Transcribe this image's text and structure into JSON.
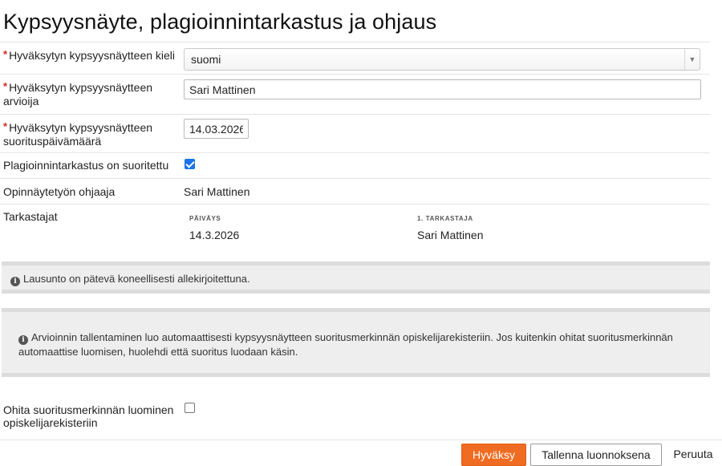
{
  "page": {
    "title": "Kypsyysnäyte, plagioinnintarkastus ja ohjaus"
  },
  "form": {
    "required_mark": "*",
    "language": {
      "label": "Hyväksytyn kypsyysnäytteen kieli",
      "value": "suomi"
    },
    "evaluator": {
      "label_line1": "Hyväksytyn kypsyysnäytteen",
      "label_line2": "arvioija",
      "value": "Sari Mattinen"
    },
    "date": {
      "label_line1": "Hyväksytyn kypsyysnäytteen",
      "label_line2": "suorituspäivämäärä",
      "value": "14.03.2026"
    },
    "plagiarism_check": {
      "label": "Plagioinnintarkastus on suoritettu",
      "checked": true
    },
    "supervisor": {
      "label": "Opinnäytetyön ohjaaja",
      "value": "Sari Mattinen"
    },
    "reviewers": {
      "label": "Tarkastajat",
      "headers": {
        "date": "PÄIVÄYS",
        "reviewer": "1. TARKASTAJA"
      },
      "date": "14.3.2026",
      "reviewer": "Sari Mattinen"
    },
    "skip_record": {
      "label_line1": "Ohita suoritusmerkinnän luominen",
      "label_line2": "opiskelijarekisteriin",
      "checked": false
    }
  },
  "notices": {
    "signature": "Lausunto on pätevä koneellisesti allekirjoitettuna.",
    "registry_line1": "Arvioinnin tallentaminen luo automaattisesti kypsyysnäytteen suoritusmerkinnän opiskelijarekisteriin. Jos kuitenkin ohitat suoritusmerkinnän",
    "registry_line2": "automaattise luomisen, huolehdi että suoritus luodaan käsin."
  },
  "actions": {
    "approve": "Hyväksy",
    "save_draft": "Tallenna luonnoksena",
    "cancel": "Peruuta"
  },
  "colors": {
    "primary": "#f06c22",
    "required": "#d9251c",
    "checkbox": "#1a73e8"
  }
}
